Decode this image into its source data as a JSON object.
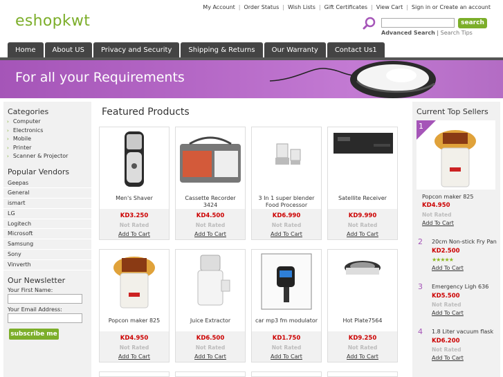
{
  "header": {
    "logo": "eshopkwt",
    "toplinks": [
      "My Account",
      "Order Status",
      "Wish Lists",
      "Gift Certificates",
      "View Cart",
      "Sign in or Create an account"
    ],
    "search_button": "search",
    "advanced_search": "Advanced Search",
    "search_tips": "Search Tips"
  },
  "nav": [
    "Home",
    "About US",
    "Privacy and Security",
    "Shipping & Returns",
    "Our Warranty",
    "Contact Us1"
  ],
  "banner": {
    "text": "For all your Requirements"
  },
  "sidebar": {
    "categories_title": "Categories",
    "categories": [
      "Computer",
      "Electronics",
      "Mobile",
      "Printer",
      "Scanner & Projector"
    ],
    "vendors_title": "Popular Vendors",
    "vendors": [
      "Geepas",
      "General",
      "ismart",
      "LG",
      "Logitech",
      "Microsoft",
      "Samsung",
      "Sony",
      "Vinverth"
    ],
    "newsletter_title": "Our Newsletter",
    "first_name_label": "Your First Name:",
    "email_label": "Your Email Address:",
    "subscribe_button": "subscribe me"
  },
  "main": {
    "title": "Featured Products",
    "products": [
      {
        "name": "Men's Shaver",
        "price": "KD3.250",
        "rating": "Not Rated",
        "add": "Add To Cart"
      },
      {
        "name": "Cassette Recorder 3424",
        "price": "KD4.500",
        "rating": "Not Rated",
        "add": "Add To Cart"
      },
      {
        "name": "3 In 1 super blender Food Processor",
        "price": "KD6.990",
        "rating": "Not Rated",
        "add": "Add To Cart"
      },
      {
        "name": "Satellite Receiver",
        "price": "KD9.990",
        "rating": "Not Rated",
        "add": "Add To Cart"
      },
      {
        "name": "Popcon maker 825",
        "price": "KD4.950",
        "rating": "Not Rated",
        "add": "Add To Cart"
      },
      {
        "name": "Juice Extractor",
        "price": "KD6.500",
        "rating": "Not Rated",
        "add": "Add To Cart"
      },
      {
        "name": "car mp3 fm modulator",
        "price": "KD1.750",
        "rating": "Not Rated",
        "add": "Add To Cart"
      },
      {
        "name": "Hot Plate7564",
        "price": "KD9.250",
        "rating": "Not Rated",
        "add": "Add To Cart"
      }
    ]
  },
  "top_sellers": {
    "title": "Current Top Sellers",
    "items": [
      {
        "rank": "1",
        "name": "Popcon maker 825",
        "price": "KD4.950",
        "rating": "Not Rated",
        "add": "Add To Cart"
      },
      {
        "rank": "2",
        "name": "20cm Non-stick Fry Pan",
        "price": "KD2.500",
        "rating_stars": 5,
        "add": "Add To Cart"
      },
      {
        "rank": "3",
        "name": "Emergency Ligh 636",
        "price": "KD5.500",
        "rating": "Not Rated",
        "add": "Add To Cart"
      },
      {
        "rank": "4",
        "name": "1.8 Liter vacuum flask",
        "price": "KD6.200",
        "rating": "Not Rated",
        "add": "Add To Cart"
      }
    ]
  },
  "colors": {
    "accent_green": "#7cae2a",
    "accent_purple": "#a555b8",
    "price_red": "#cc0000"
  }
}
